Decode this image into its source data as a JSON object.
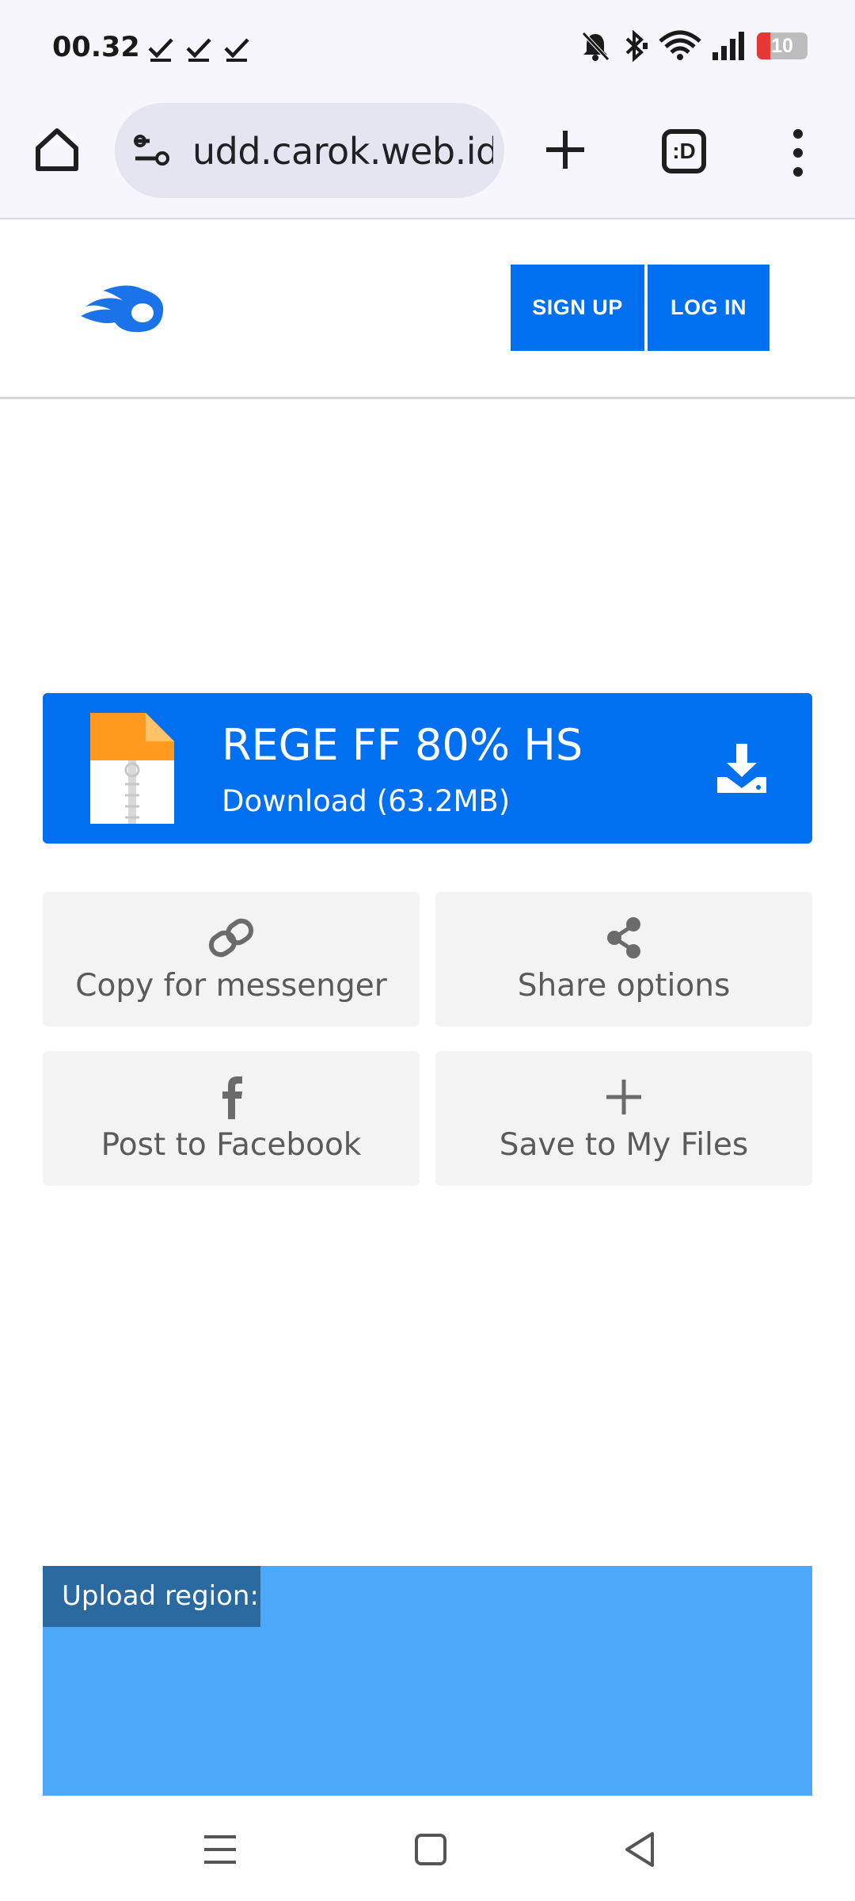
{
  "status_bar": {
    "time": "00.32",
    "battery_level": "10",
    "icons": [
      "check-icon",
      "check-icon",
      "check-icon",
      "bell-off-icon",
      "bluetooth-icon",
      "wifi-icon",
      "signal-icon",
      "battery-icon"
    ]
  },
  "browser": {
    "url": "udd.carok.web.id",
    "tab_count_label": ":D",
    "icons": [
      "home-icon",
      "site-info-icon",
      "new-tab-icon",
      "tab-switcher-icon",
      "more-menu-icon"
    ]
  },
  "header": {
    "signup_label": "SIGN UP",
    "login_label": "LOG IN",
    "brand_color": "#0070f0"
  },
  "file": {
    "name": "REGE FF 80% HS",
    "download_label": "Download (63.2MB)"
  },
  "actions": {
    "copy_label": "Copy for messenger",
    "share_label": "Share options",
    "facebook_label": "Post to Facebook",
    "save_label": "Save to My Files"
  },
  "upload": {
    "label": "Upload region:"
  }
}
